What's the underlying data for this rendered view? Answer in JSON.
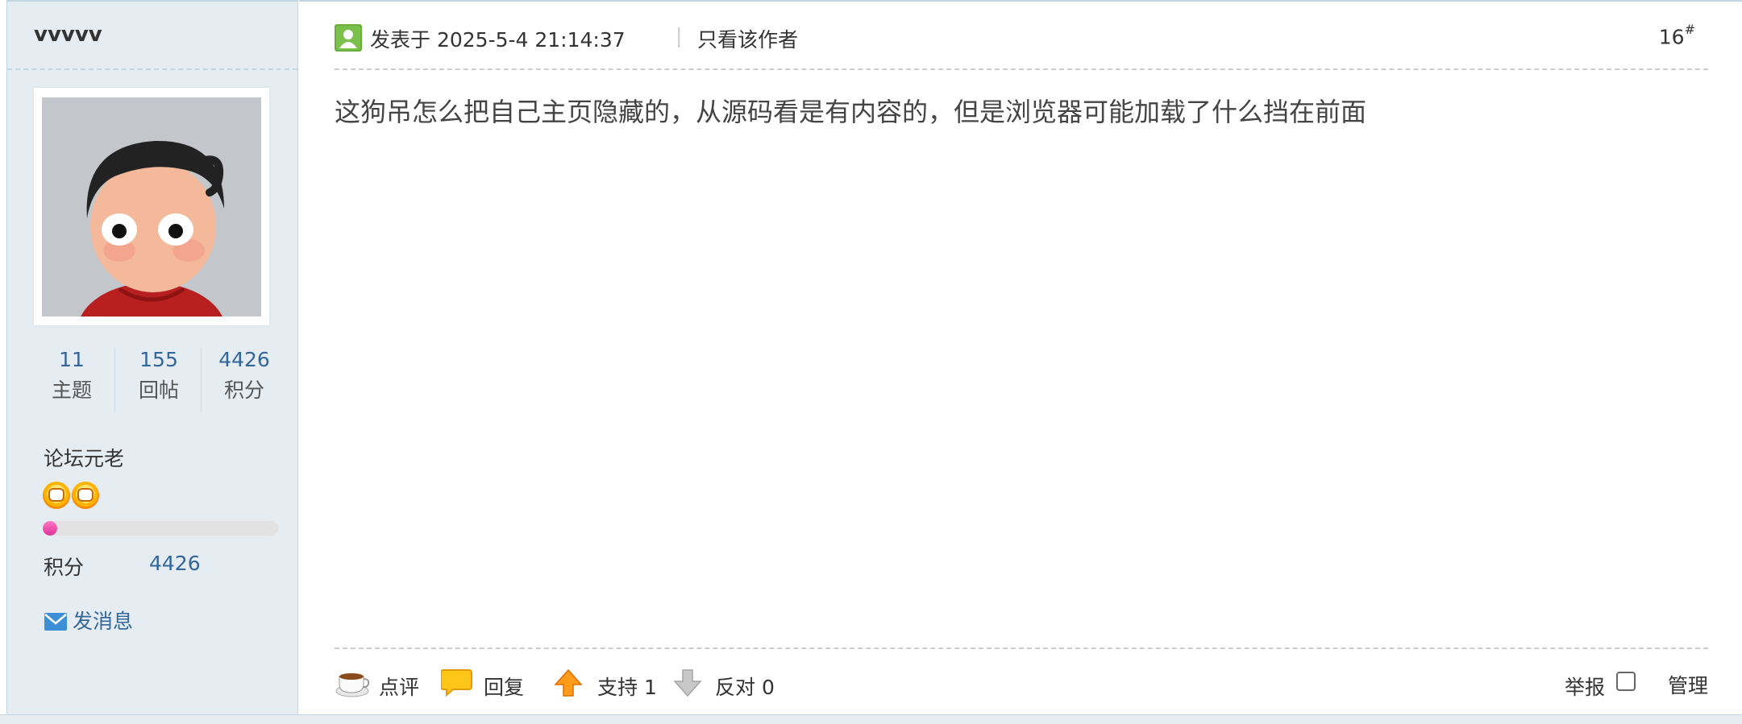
{
  "author": {
    "username": "vvvvv",
    "stats": [
      {
        "value": "11",
        "label": "主题"
      },
      {
        "value": "155",
        "label": "回帖"
      },
      {
        "value": "4426",
        "label": "积分"
      }
    ],
    "rank_title": "论坛元老",
    "rank_icon": "smiley-face-icon",
    "rank_progress_fraction": 0.06,
    "credit_label": "积分",
    "credit_value": "4426",
    "send_message_label": "发消息"
  },
  "post": {
    "posted_at": "发表于 2025-5-4 21:14:37",
    "separator": "|",
    "only_author_label": "只看该作者",
    "floor_number": "16",
    "floor_mark": "#",
    "message": "这狗吊怎么把自己主页隐藏的，从源码看是有内容的，但是浏览器可能加载了什么挡在前面"
  },
  "actions": {
    "comment_label": "点评",
    "reply_label": "回复",
    "support_label": "支持 1",
    "oppose_label": "反对 0",
    "report_label": "举报",
    "manage_label": "管理"
  },
  "colors": {
    "sidebar_bg": "#e5edf2",
    "sidebar_border": "#c2d5e3",
    "link_blue": "#336699",
    "progress_pink": "#e0329a"
  }
}
